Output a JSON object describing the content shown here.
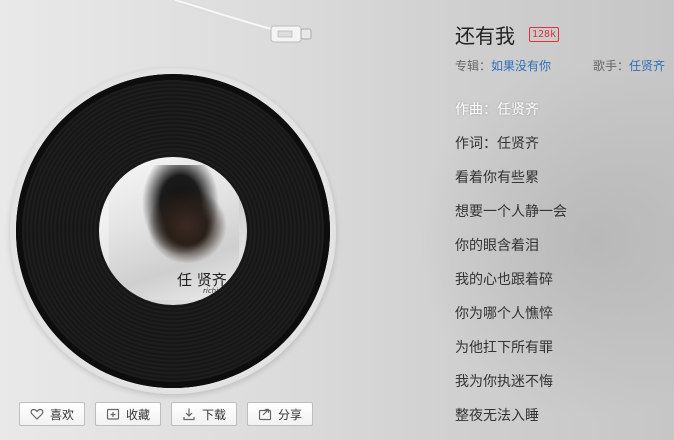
{
  "song": {
    "title": "还有我",
    "quality": "128k",
    "album_label": "专辑：",
    "album": "如果没有你",
    "artist_label": "歌手：",
    "artist": "任贤齐"
  },
  "cover": {
    "artist_mark": "任 贤齐",
    "artist_sub": "richie"
  },
  "lyrics": [
    "作曲：任贤齐",
    "作词：任贤齐",
    "看着你有些累",
    "想要一个人静一会",
    "你的眼含着泪",
    "我的心也跟着碎",
    "你为哪个人憔悴",
    "为他扛下所有罪",
    "我为你执迷不悔",
    "整夜无法入睡"
  ],
  "actions": [
    {
      "label": "喜欢",
      "icon": "heart-icon"
    },
    {
      "label": "收藏",
      "icon": "add-folder-icon"
    },
    {
      "label": "下载",
      "icon": "download-icon"
    },
    {
      "label": "分享",
      "icon": "share-icon"
    }
  ],
  "colors": {
    "accent_link": "#2e6fb7",
    "quality_badge": "#dd3333",
    "active_lyric": "#ffffff"
  }
}
